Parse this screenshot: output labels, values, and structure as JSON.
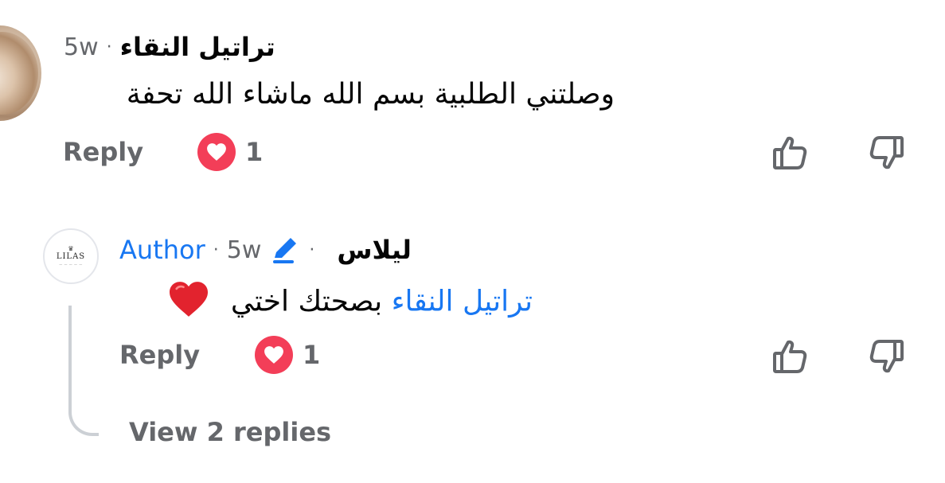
{
  "comment": {
    "author": "تراتيل  النقاء",
    "time": "5w",
    "separator": "·",
    "text": "وصلتني الطلبية بسم الله ماشاء الله تحفة",
    "reply_label": "Reply",
    "reaction_count": "1"
  },
  "reply": {
    "author": "ليلاس",
    "author_badge": "Author",
    "time": "5w",
    "separator": "·",
    "mention": "تراتيل النقاء",
    "text": "بصحتك اختي",
    "emoji": "❤️",
    "reply_label": "Reply",
    "reaction_count": "1",
    "avatar_logo": "LILAS",
    "avatar_mark": "♛"
  },
  "view_replies_label": "View 2 replies",
  "colors": {
    "text": "#050505",
    "secondary": "#65676b",
    "link": "#1877f2",
    "heart": "#f33e58",
    "thread_line": "#ccd0d5"
  },
  "icons": [
    "heart-reaction-icon",
    "thumbs-up-icon",
    "thumbs-down-icon",
    "pencil-icon",
    "red-heart-emoji"
  ]
}
